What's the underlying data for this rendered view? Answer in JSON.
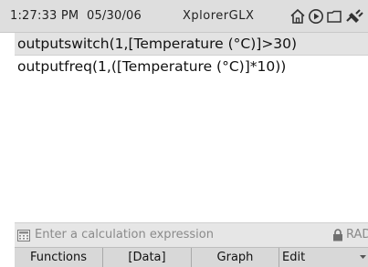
{
  "status_bar": {
    "time": "1:27:33 PM",
    "date": "05/30/06",
    "app_name": "XplorerGLX",
    "icons": [
      "home-icon",
      "play-icon",
      "folder-icon",
      "power-plug-icon"
    ]
  },
  "expressions": [
    "outputswitch(1,[Temperature (°C)]>30)",
    "outputfreq(1,([Temperature (°C)]*10))"
  ],
  "input_bar": {
    "placeholder": "Enter a calculation expression",
    "mode": "RAD"
  },
  "softkeys": [
    "Functions",
    "[Data]",
    "Graph",
    "Edit"
  ],
  "colors": {
    "status_bg": "#dedede",
    "selected_row_bg": "#e3e3e3",
    "input_bar_bg": "#e6e6e6",
    "softkey_bg": "#d8d8d8"
  }
}
